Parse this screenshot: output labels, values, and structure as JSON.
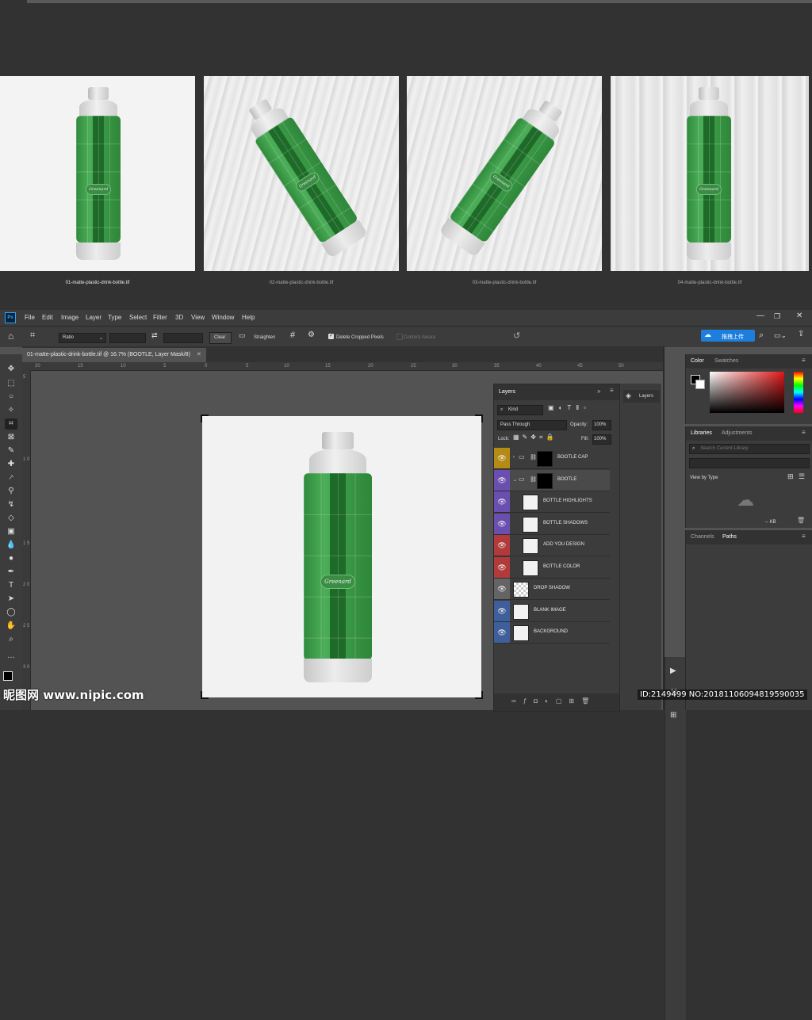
{
  "gallery": {
    "thumbnails": [
      {
        "filename": "01-matte-plastic-drink-bottle.tif",
        "background": "plain white",
        "selected": true
      },
      {
        "filename": "02-matte-plastic-drink-bottle.tif",
        "background": "wood planks",
        "selected": false
      },
      {
        "filename": "03-matte-plastic-drink-bottle.tif",
        "background": "wood planks",
        "selected": false
      },
      {
        "filename": "04-matte-plastic-drink-bottle.tif",
        "background": "wood planks",
        "selected": false
      }
    ],
    "bottle_logo": "Greenard"
  },
  "app": {
    "menu": [
      "File",
      "Edit",
      "Image",
      "Layer",
      "Type",
      "Select",
      "Filter",
      "3D",
      "View",
      "Window",
      "Help"
    ],
    "options": {
      "ratio": "Ratio",
      "clear": "Clear",
      "straighten": "Straighten",
      "delete_cropped": "Delete Cropped Pixels",
      "content_aware": "Content-Aware",
      "upload_button": "拖拽上传"
    },
    "document_tab": "01-matte-plastic-drink-bottle.tif @ 16.7% (BOOTLE, Layer Mask/8)",
    "ruler_h": [
      "20",
      "15",
      "10",
      "5",
      "0",
      "5",
      "10",
      "15",
      "20",
      "25",
      "30",
      "35",
      "40",
      "45",
      "50"
    ],
    "ruler_v": [
      "5",
      "1 0",
      "1 5",
      "2 0",
      "2 5",
      "3 0"
    ]
  },
  "layers_panel": {
    "title": "Layers",
    "filter": "Kind",
    "blend_mode": "Pass Through",
    "opacity_label": "Opacity:",
    "opacity": "100%",
    "lock_label": "Lock:",
    "fill_label": "Fill:",
    "fill": "100%",
    "layers": [
      {
        "name": "BOOTLE CAP",
        "color": "#b58b16",
        "group": true
      },
      {
        "name": "BOOTLE",
        "color": "#6a4fb0",
        "group": true,
        "selected": true
      },
      {
        "name": "BOTTLE HIGHLIGHTS",
        "color": "#6a4fb0"
      },
      {
        "name": "BOTTLE SHADOWS",
        "color": "#6a4fb0"
      },
      {
        "name": "ADD YOU DESIGN",
        "color": "#b33a3a"
      },
      {
        "name": "BOTTLE COLOR",
        "color": "#b33a3a"
      },
      {
        "name": "DROP SHADOW",
        "color": "#646464"
      },
      {
        "name": "BLANK IMAGE",
        "color": "#3f5f9c"
      },
      {
        "name": "BACKGROUND",
        "color": "#3f5f9c"
      }
    ],
    "side_tab": "Layers"
  },
  "right_panels": {
    "color_tabs": [
      "Color",
      "Swatches"
    ],
    "libraries_tabs": [
      "Libraries",
      "Adjustments"
    ],
    "search_placeholder": "Search Current Library",
    "view_by": "View by Type",
    "kb": "-- KB",
    "channels_tabs": [
      "Channels",
      "Paths"
    ]
  },
  "watermark": {
    "site": "昵图网 www.nipic.com",
    "id": "ID:2149499 NO:20181106094819590035"
  }
}
